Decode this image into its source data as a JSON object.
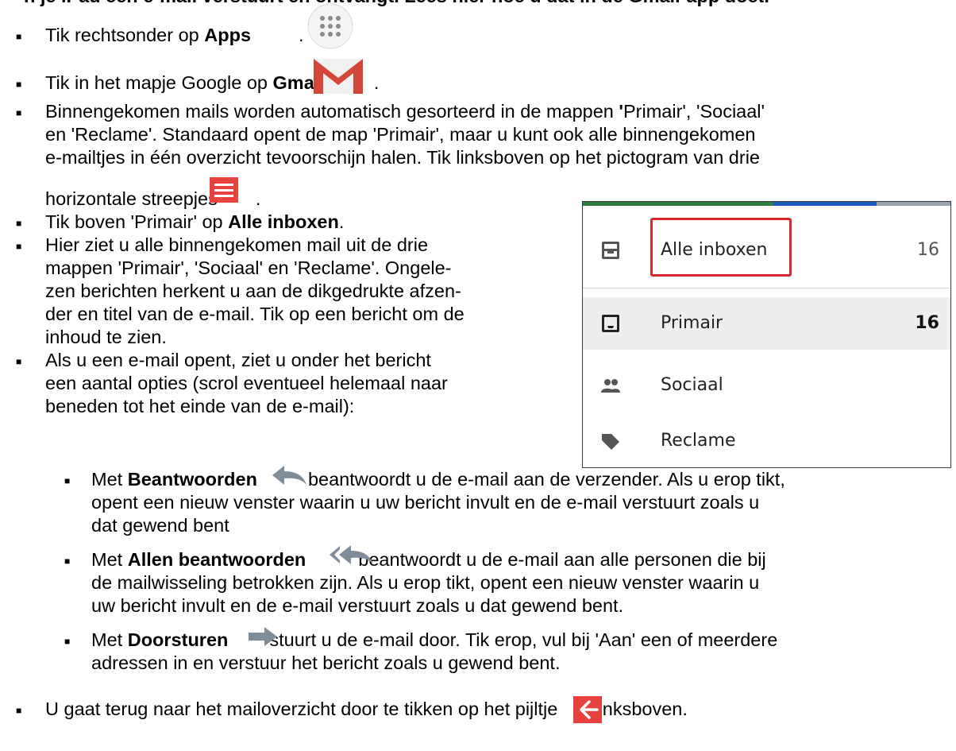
{
  "top_cut_text": "n je iPad een e-mail verstuurt en ontvangt. Lees hier hoe u dat in de Gmail-app doet.",
  "items": {
    "apps": {
      "pre": "Tik rechtsonder op ",
      "bold": "Apps",
      "post": "."
    },
    "gmail": {
      "pre": "Tik in het mapje Google op ",
      "bold": "Gmail",
      "post": "."
    },
    "sorted": {
      "l1a": "Binnengekomen mails worden automatisch gesorteerd in de mappen ",
      "l1b": "'",
      "l1c": "Primair', 'Sociaal'",
      "l2": "en 'Reclame'. Standaard opent de map 'Primair', maar u kunt ook alle binnengekomen",
      "l3": "e-mailtjes in één overzicht tevoorschijn halen. Tik linksboven op het pictogram van drie",
      "l4": "horizontale streepjes",
      "l4post": "."
    },
    "alle": {
      "pre": "Tik boven 'Primair' op ",
      "bold": "Alle inboxen",
      "post": "."
    },
    "hier": {
      "l1": "Hier ziet u alle binnengekomen mail uit de drie",
      "l2": "mappen 'Primair', 'Sociaal' en 'Reclame'. Ongele-",
      "l3": "zen berichten herkent u aan de dikgedrukte afzen-",
      "l4": "der en titel van de e-mail. Tik op een bericht om de",
      "l5": "inhoud te zien."
    },
    "opent": {
      "l1": "Als u een e-mail opent, ziet u onder het bericht",
      "l2": "een aantal opties (scrol eventueel helemaal naar",
      "l3": "beneden tot het einde van de e-mail):"
    },
    "beant": {
      "pre": "Met ",
      "bold": "Beantwoorden",
      "l1post": "beantwoordt u de e-mail aan de verzender. Als u erop tikt,",
      "l2": "opent een nieuw venster waarin u uw bericht invult en de e-mail verstuurt zoals u",
      "l3": "dat gewend bent"
    },
    "allen": {
      "pre": "Met ",
      "bold": "Allen beantwoorden",
      "l1post": "beantwoordt u de e-mail aan alle personen die bij",
      "l2": "de mailwisseling betrokken zijn. Als u erop tikt, opent een nieuw venster waarin u",
      "l3": "uw bericht invult en de e-mail verstuurt zoals u dat gewend bent."
    },
    "door": {
      "pre": "Met ",
      "bold": "Doorsturen",
      "l1post": "stuurt u de e-mail door. Tik erop, vul bij 'Aan' een of meerdere",
      "l2": "adressen in en verstuur het bericht zoals u gewend bent."
    },
    "terug": {
      "pre": "U gaat terug naar het mailoverzicht door te tikken op het pijltje",
      "post": "linksboven."
    }
  },
  "gmail_menu": {
    "rows": [
      {
        "label": "Alle inboxen",
        "count": "16",
        "icon": "all-inboxes-icon"
      },
      {
        "label": "Primair",
        "count": "16",
        "icon": "inbox-icon"
      },
      {
        "label": "Sociaal",
        "count": "",
        "icon": "people-icon"
      },
      {
        "label": "Reclame",
        "count": "",
        "icon": "tag-icon"
      }
    ],
    "highlight_color": "#d7282f"
  },
  "colors": {
    "menu_icon_red": "#e8423f",
    "reply_icon": "#7f8c99",
    "gmail_red": "#d44638"
  },
  "bullet_glyph": "■"
}
